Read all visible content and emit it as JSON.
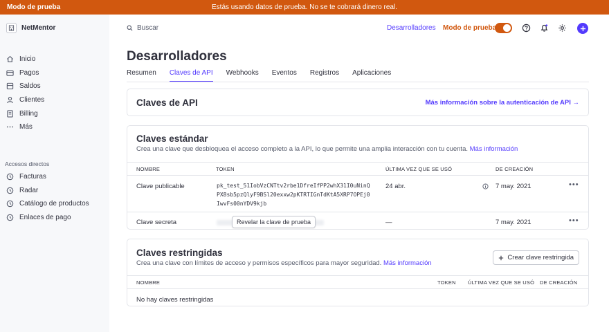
{
  "banner": {
    "left": "Modo de prueba",
    "center": "Estás usando datos de prueba. No se te cobrará dinero real."
  },
  "brand": {
    "name": "NetMentor"
  },
  "search": {
    "placeholder": "Buscar"
  },
  "topbar": {
    "developers_link": "Desarrolladores",
    "test_mode_label": "Modo de prueba",
    "test_mode_on": true
  },
  "sidebar": {
    "items": [
      {
        "label": "Inicio",
        "icon": "home-icon"
      },
      {
        "label": "Pagos",
        "icon": "payments-icon"
      },
      {
        "label": "Saldos",
        "icon": "balances-icon"
      },
      {
        "label": "Clientes",
        "icon": "customers-icon"
      },
      {
        "label": "Billing",
        "icon": "billing-icon"
      },
      {
        "label": "Más",
        "icon": "more-icon"
      }
    ],
    "section_title": "Accesos directos",
    "shortcuts": [
      {
        "label": "Facturas",
        "icon": "clock-icon"
      },
      {
        "label": "Radar",
        "icon": "clock-icon"
      },
      {
        "label": "Catálogo de productos",
        "icon": "clock-icon"
      },
      {
        "label": "Enlaces de pago",
        "icon": "clock-icon"
      }
    ]
  },
  "page": {
    "title": "Desarrolladores",
    "tabs": [
      "Resumen",
      "Claves de API",
      "Webhooks",
      "Eventos",
      "Registros",
      "Aplicaciones"
    ],
    "active_tab": 1
  },
  "api_keys_card": {
    "title": "Claves de API",
    "link": "Más información sobre la autenticación de API →"
  },
  "standard_keys": {
    "title": "Claves estándar",
    "subtitle": "Crea una clave que desbloquea el acceso completo a la API, lo que permite una amplia interacción con tu cuenta.",
    "subtitle_link": "Más información",
    "columns": [
      "NOMBRE",
      "TOKEN",
      "ÚLTIMA VEZ QUE SE USÓ",
      "DE CREACIÓN"
    ],
    "rows": [
      {
        "name": "Clave publicable",
        "token_lines": [
          "pk_test_51IobVzCNTtv2rbe1DfreIfPP2whX31I0uNinQ",
          "PX8sb5pzQlyF9BSl20exxw2pKTRTIGnTdKtA5XRP7OPEj0",
          "IwvFs00nYDV9kjb"
        ],
        "last_used": "24 abr.",
        "created": "7 may. 2021"
      },
      {
        "name": "Clave secreta",
        "reveal_label": "Revelar la clave de prueba",
        "last_used": "—",
        "created": "7 may. 2021"
      }
    ],
    "menu_glyph": "•••"
  },
  "restricted_keys": {
    "title": "Claves restringidas",
    "subtitle": "Crea una clave con límites de acceso y permisos específicos para mayor seguridad.",
    "subtitle_link": "Más información",
    "create_button": "Crear clave restringida",
    "columns": [
      "NOMBRE",
      "TOKEN",
      "ÚLTIMA VEZ QUE SE USÓ",
      "DE CREACIÓN"
    ],
    "empty_text": "No hay claves restringidas"
  },
  "colors": {
    "accent": "#533afd",
    "test_mode": "#d1580f",
    "text": "#30313d",
    "muted": "#545969",
    "border": "#e3e5ea"
  }
}
